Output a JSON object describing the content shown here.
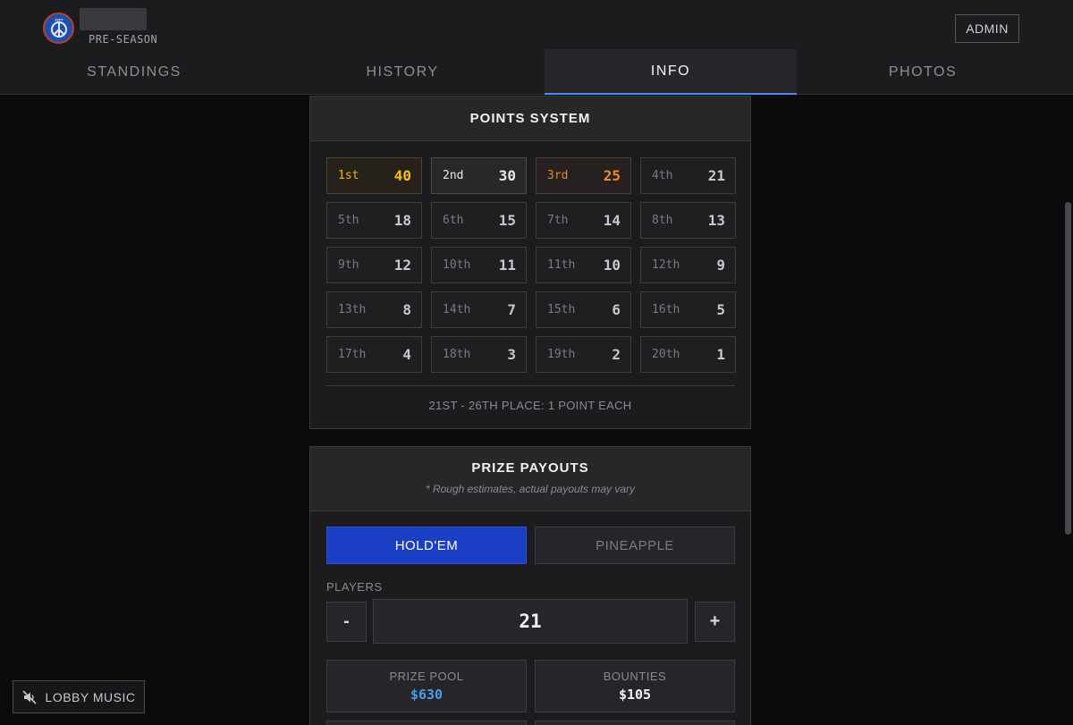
{
  "header": {
    "logo_text": "JSPT",
    "season": "PRE-SEASON",
    "admin_label": "ADMIN",
    "tabs": [
      {
        "label": "STANDINGS",
        "active": false
      },
      {
        "label": "HISTORY",
        "active": false
      },
      {
        "label": "INFO",
        "active": true
      },
      {
        "label": "PHOTOS",
        "active": false
      }
    ]
  },
  "points_system": {
    "title": "POINTS SYSTEM",
    "places": [
      {
        "place": "1st",
        "points": "40"
      },
      {
        "place": "2nd",
        "points": "30"
      },
      {
        "place": "3rd",
        "points": "25"
      },
      {
        "place": "4th",
        "points": "21"
      },
      {
        "place": "5th",
        "points": "18"
      },
      {
        "place": "6th",
        "points": "15"
      },
      {
        "place": "7th",
        "points": "14"
      },
      {
        "place": "8th",
        "points": "13"
      },
      {
        "place": "9th",
        "points": "12"
      },
      {
        "place": "10th",
        "points": "11"
      },
      {
        "place": "11th",
        "points": "10"
      },
      {
        "place": "12th",
        "points": "9"
      },
      {
        "place": "13th",
        "points": "8"
      },
      {
        "place": "14th",
        "points": "7"
      },
      {
        "place": "15th",
        "points": "6"
      },
      {
        "place": "16th",
        "points": "5"
      },
      {
        "place": "17th",
        "points": "4"
      },
      {
        "place": "18th",
        "points": "3"
      },
      {
        "place": "19th",
        "points": "2"
      },
      {
        "place": "20th",
        "points": "1"
      }
    ],
    "note": "21ST - 26TH PLACE: 1 POINT EACH"
  },
  "prize_payouts": {
    "title": "PRIZE PAYOUTS",
    "subtitle": "* Rough estimates, actual payouts may vary",
    "games": [
      {
        "label": "HOLD'EM",
        "active": true
      },
      {
        "label": "PINEAPPLE",
        "active": false
      }
    ],
    "players_label": "PLAYERS",
    "minus_label": "-",
    "plus_label": "+",
    "players": "21",
    "prize_pool_label": "PRIZE POOL",
    "prize_pool": "$630",
    "bounties_label": "BOUNTIES",
    "bounties": "$105"
  },
  "lobby_music": {
    "label": "LOBBY MUSIC",
    "icon": "speaker-muted-icon"
  },
  "colors": {
    "accent_blue": "#4b8bf0",
    "active_game": "#1a3ec4",
    "gold": "#f5bf1a",
    "bronze": "#f08b2c"
  }
}
